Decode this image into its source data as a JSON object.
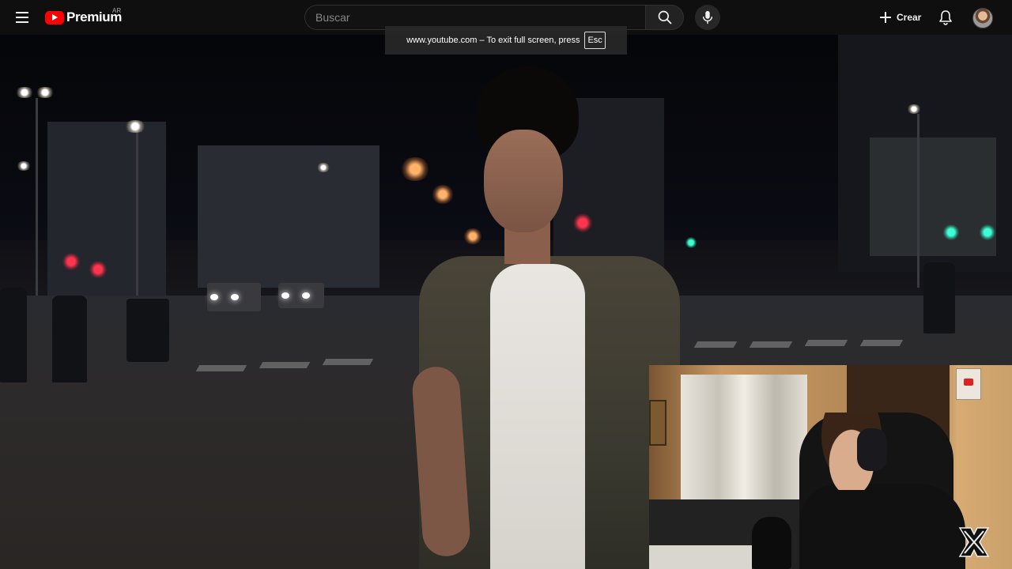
{
  "masthead": {
    "menu_icon": "hamburger-menu-icon",
    "logo": {
      "text": "Premium",
      "region": "AR",
      "icon": "youtube-play-icon",
      "brand_color": "#ff0000"
    },
    "search": {
      "placeholder": "Buscar",
      "value": ""
    },
    "search_icon": "search-icon",
    "mic_icon": "microphone-icon",
    "create": {
      "label": "Crear",
      "icon": "plus-icon"
    },
    "notifications_icon": "bell-icon",
    "avatar_icon": "user-avatar"
  },
  "fullscreen_notice": {
    "message": "www.youtube.com – To exit full screen, press",
    "key": "Esc"
  },
  "colors": {
    "masthead_bg": "#0f0f0f",
    "text": "#f1f1f1",
    "placeholder": "#888888",
    "brand": "#ff0000"
  }
}
